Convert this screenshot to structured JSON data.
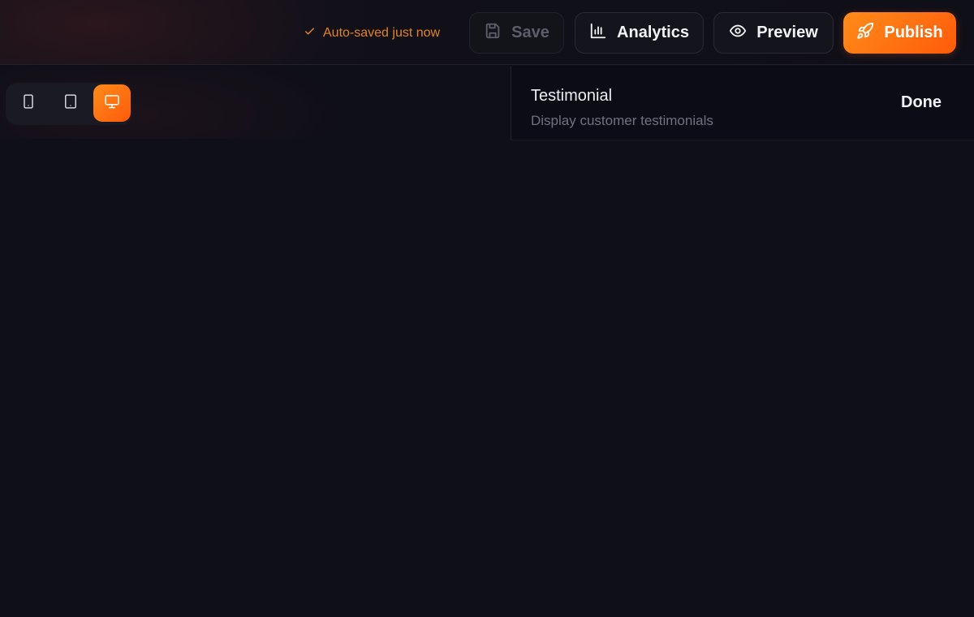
{
  "header": {
    "autosave_text": "Auto-saved just now",
    "save_label": "Save",
    "analytics_label": "Analytics",
    "preview_label": "Preview",
    "publish_label": "Publish"
  },
  "device_toolbar": {
    "devices": [
      {
        "name": "mobile",
        "icon": "smartphone-icon",
        "active": false
      },
      {
        "name": "tablet",
        "icon": "tablet-icon",
        "active": false
      },
      {
        "name": "desktop",
        "icon": "monitor-icon",
        "active": true
      }
    ]
  },
  "panel": {
    "title": "Testimonial",
    "subtitle": "Display customer testimonials",
    "done_label": "Done"
  },
  "colors": {
    "accent": "#ff7a12",
    "autosave": "#e38324",
    "background": "#0f0f18"
  }
}
